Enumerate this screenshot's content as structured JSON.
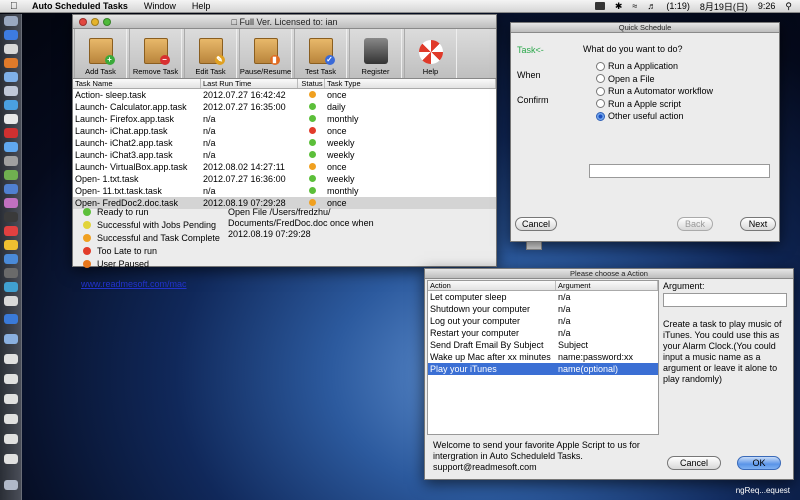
{
  "menubar": {
    "app_name": "Auto Scheduled Tasks",
    "menus": [
      "Window",
      "Help"
    ],
    "battery": "(1:19)",
    "date": "8月19日(日)",
    "time": "9:26"
  },
  "main_window": {
    "title": "Full Ver. Licensed to: ian",
    "toolbar": [
      "Add Task",
      "Remove Task",
      "Edit Task",
      "Pause/Resume",
      "Test Task",
      "Register",
      "Help"
    ],
    "columns": [
      "Task Name",
      "Last Run Time",
      "Status",
      "Task Type"
    ],
    "rows": [
      {
        "name": "Action- sleep.task",
        "last_run": "2012.07.27 16:42:42",
        "status": "#f0a020",
        "type": "once"
      },
      {
        "name": "Launch- Calculator.app.task",
        "last_run": "2012.07.27 16:35:00",
        "status": "#5cbf3a",
        "type": "daily"
      },
      {
        "name": "Launch- Firefox.app.task",
        "last_run": "n/a",
        "status": "#5cbf3a",
        "type": "monthly"
      },
      {
        "name": "Launch- iChat.app.task",
        "last_run": "n/a",
        "status": "#e23c2a",
        "type": "once"
      },
      {
        "name": "Launch- iChat2.app.task",
        "last_run": "n/a",
        "status": "#5cbf3a",
        "type": "weekly"
      },
      {
        "name": "Launch- iChat3.app.task",
        "last_run": "n/a",
        "status": "#5cbf3a",
        "type": "weekly"
      },
      {
        "name": "Launch- VirtualBox.app.task",
        "last_run": "2012.08.02 14:27:11",
        "status": "#f0a020",
        "type": "once"
      },
      {
        "name": "Open- 1.txt.task",
        "last_run": "2012.07.27 16:36:00",
        "status": "#5cbf3a",
        "type": "weekly"
      },
      {
        "name": "Open- 11.txt.task.task",
        "last_run": "n/a",
        "status": "#5cbf3a",
        "type": "monthly"
      },
      {
        "name": "Open- FredDoc2.doc.task",
        "last_run": "2012.08.19 07:29:28",
        "status": "#f0a020",
        "type": "once"
      }
    ],
    "legend": [
      {
        "color": "#5cbf3a",
        "label": "Ready to run"
      },
      {
        "color": "#e2d43a",
        "label": "Successful with Jobs Pending"
      },
      {
        "color": "#f0a020",
        "label": "Successful and Task Complete"
      },
      {
        "color": "#e23c2a",
        "label": "Too Late to run"
      },
      {
        "color": "#e8761a",
        "label": "User Paused"
      }
    ],
    "detail_lines": [
      "Open File /Users/fredzhu/",
      "Documents/FredDoc.doc once when",
      "2012.08.19 07:29:28"
    ],
    "link": "www.readmesoft.com/mac"
  },
  "quick_window": {
    "title": "Quick Schedule",
    "steps": [
      "Task<-",
      "When",
      "Confirm"
    ],
    "question": "What do you want to do?",
    "options": [
      "Run a Application",
      "Open a File",
      "Run a Automator workflow",
      "Run a Apple script",
      "Other useful action"
    ],
    "selected_option": 4,
    "cancel": "Cancel",
    "back": "Back",
    "next": "Next"
  },
  "action_window": {
    "title": "Please choose a Action",
    "columns": [
      "Action",
      "Argument"
    ],
    "rows": [
      {
        "action": "Let computer sleep",
        "argument": "n/a"
      },
      {
        "action": "Shutdown your computer",
        "argument": "n/a"
      },
      {
        "action": "Log out your computer",
        "argument": "n/a"
      },
      {
        "action": "Restart your computer",
        "argument": "n/a"
      },
      {
        "action": "Send Draft Email By Subject",
        "argument": "Subject"
      },
      {
        "action": "Wake up Mac after xx minutes",
        "argument": "name:password:xx"
      },
      {
        "action": "Play your iTunes",
        "argument": "name(optional)"
      }
    ],
    "selected_row": 6,
    "argument_label": "Argument:",
    "argument_desc": "Create a task to play music of iTunes. You could use this as your Alarm Clock.(You could input a music name as a argument or leave it alone to play randomly)",
    "welcome": "Welcome to send your favorite Apple Script to us for intergration in Auto Scheduleld Tasks. support@readmesoft.com",
    "cancel": "Cancel",
    "ok": "OK"
  },
  "statusbar": "ngReq...equest"
}
